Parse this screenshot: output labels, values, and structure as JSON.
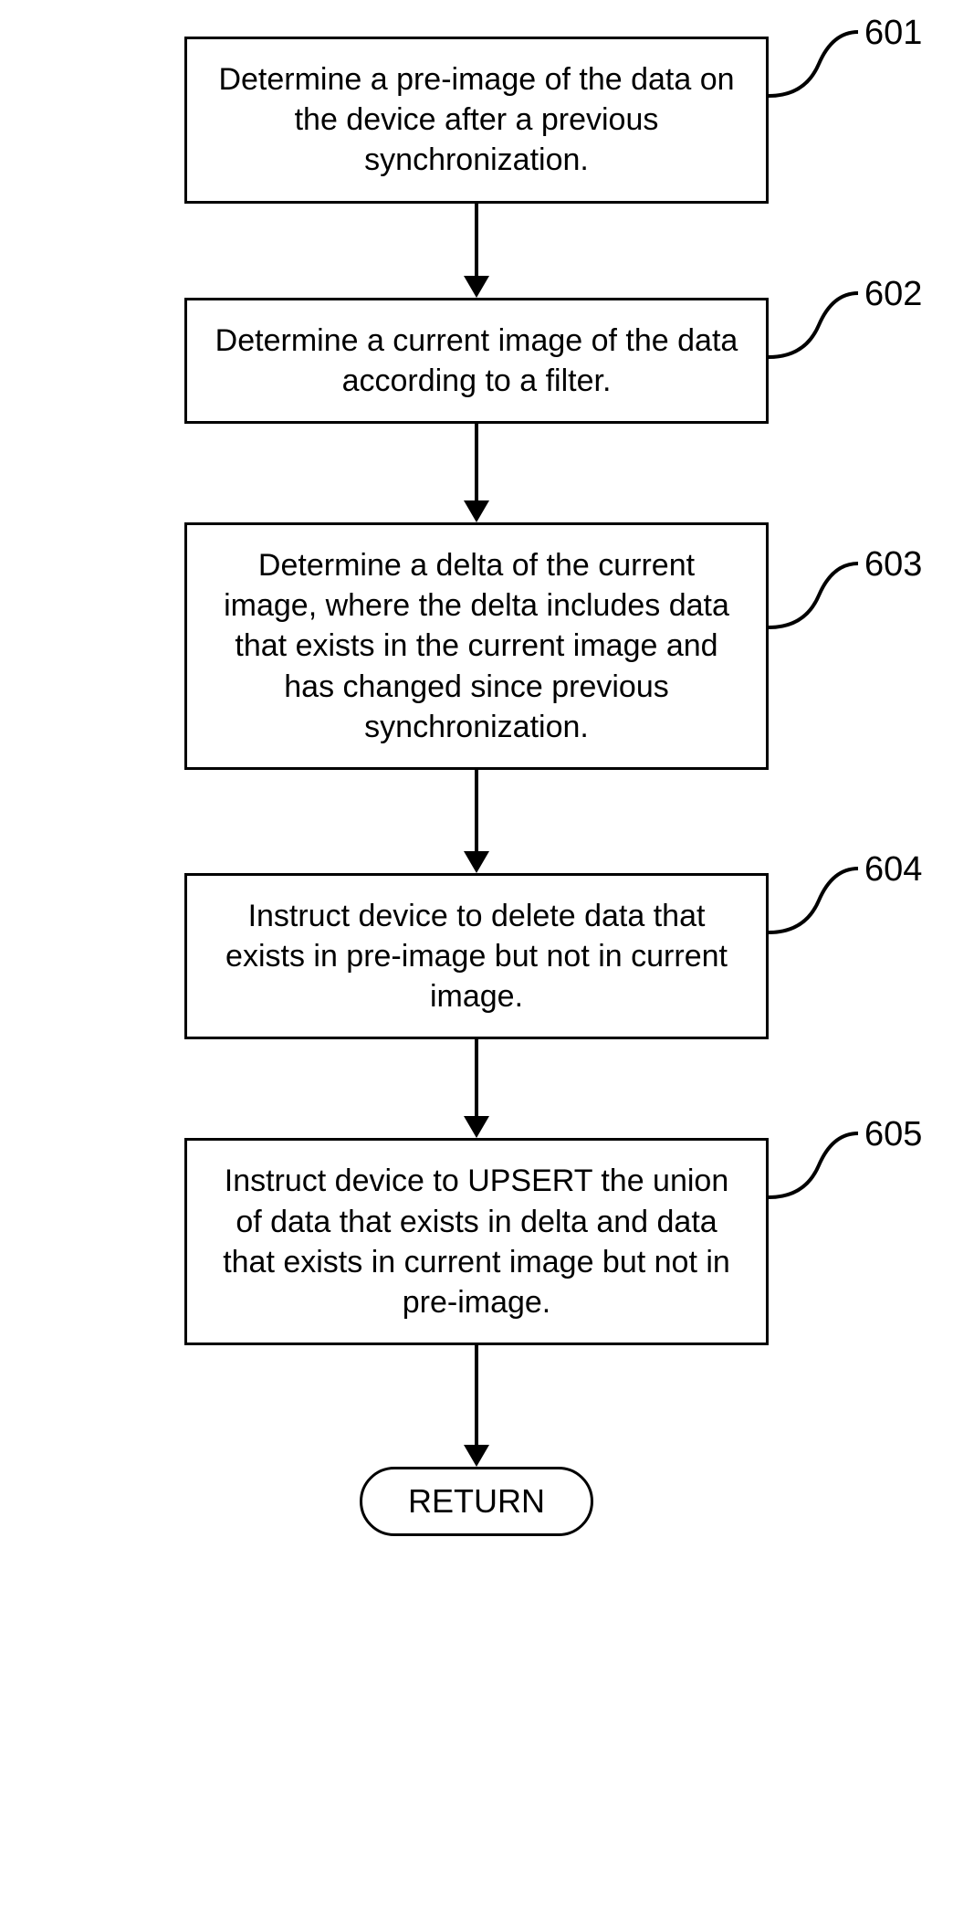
{
  "chart_data": {
    "type": "flowchart",
    "nodes": [
      {
        "id": "601",
        "label": "601",
        "text": "Determine a pre-image of the data on the device after a previous synchronization.",
        "shape": "rect"
      },
      {
        "id": "602",
        "label": "602",
        "text": "Determine a current image of the data according to a filter.",
        "shape": "rect"
      },
      {
        "id": "603",
        "label": "603",
        "text": "Determine a delta of the current image, where the delta includes data that exists in the current image and has changed since previous synchronization.",
        "shape": "rect"
      },
      {
        "id": "604",
        "label": "604",
        "text": "Instruct device to delete data that exists in pre-image but not in current image.",
        "shape": "rect"
      },
      {
        "id": "605",
        "label": "605",
        "text": "Instruct device to UPSERT the union of data that exists in delta and data that exists in current image but not in pre-image.",
        "shape": "rect"
      },
      {
        "id": "return",
        "label": "",
        "text": "RETURN",
        "shape": "terminal"
      }
    ],
    "edges": [
      {
        "from": "601",
        "to": "602"
      },
      {
        "from": "602",
        "to": "603"
      },
      {
        "from": "603",
        "to": "604"
      },
      {
        "from": "604",
        "to": "605"
      },
      {
        "from": "605",
        "to": "return"
      }
    ]
  }
}
